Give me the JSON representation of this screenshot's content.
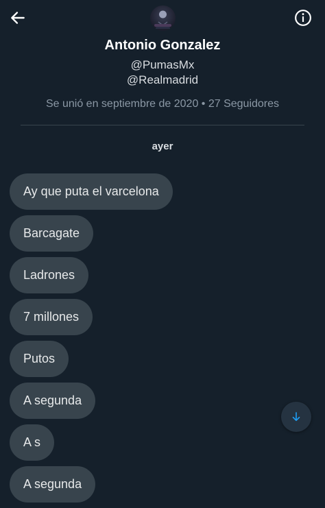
{
  "header": {
    "back_icon": "arrow-left-icon",
    "info_icon": "info-circle-icon",
    "avatar_icon": "profile-avatar"
  },
  "profile": {
    "name": "Antonio Gonzalez",
    "handles": [
      "@PumasMx",
      "@Realmadrid"
    ],
    "meta": "Se unió en septiembre de 2020 • 27 Seguidores"
  },
  "conversation": {
    "date_separator": "ayer",
    "messages": [
      {
        "text": "Ay que puta el varcelona"
      },
      {
        "text": "Barcagate"
      },
      {
        "text": "Ladrones"
      },
      {
        "text": "7 millones"
      },
      {
        "text": "Putos"
      },
      {
        "text": "A segunda"
      },
      {
        "text": "A s"
      },
      {
        "text": "A segunda"
      }
    ]
  },
  "scroll_button": {
    "icon": "arrow-down-icon"
  },
  "colors": {
    "background": "#15202b",
    "bubble": "#38444d",
    "accent": "#1d9bf0",
    "muted_text": "#8b98a5"
  }
}
